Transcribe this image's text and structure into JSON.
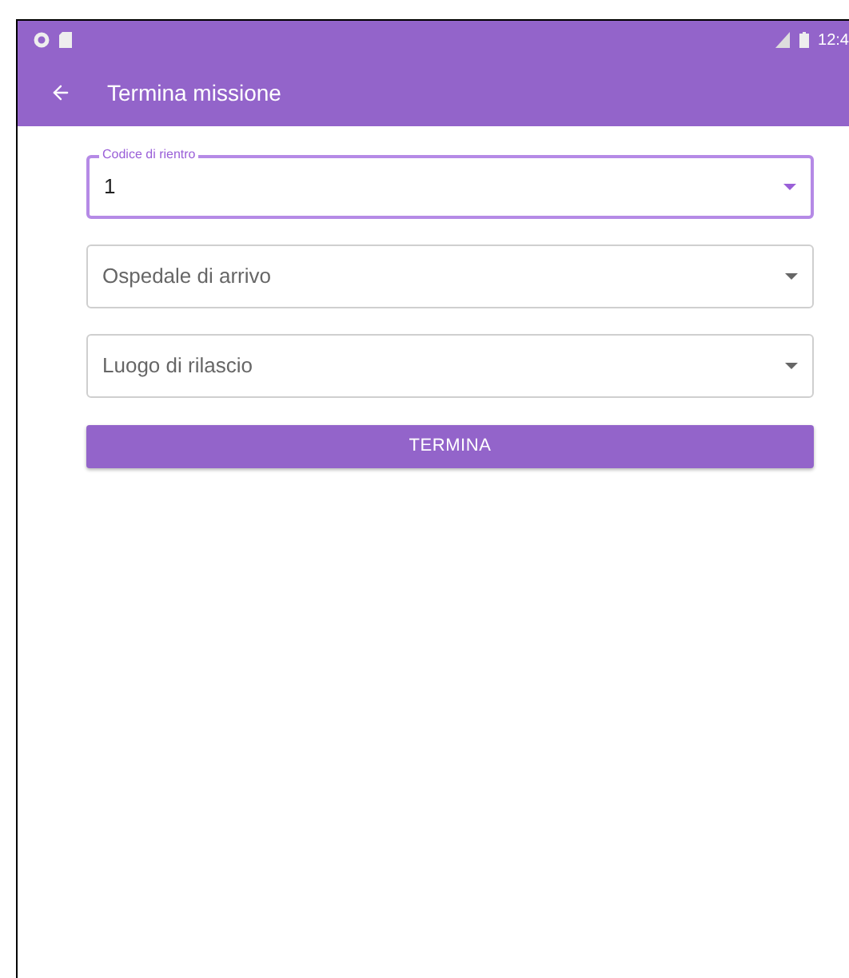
{
  "status_bar": {
    "time": "12:4"
  },
  "toolbar": {
    "title": "Termina missione"
  },
  "fields": [
    {
      "label": "Codice di rientro",
      "value": "1",
      "focused": true
    },
    {
      "label": "Ospedale di arrivo",
      "focused": false
    },
    {
      "label": "Luogo di rilascio",
      "focused": false
    }
  ],
  "button": {
    "label": "TERMINA"
  }
}
